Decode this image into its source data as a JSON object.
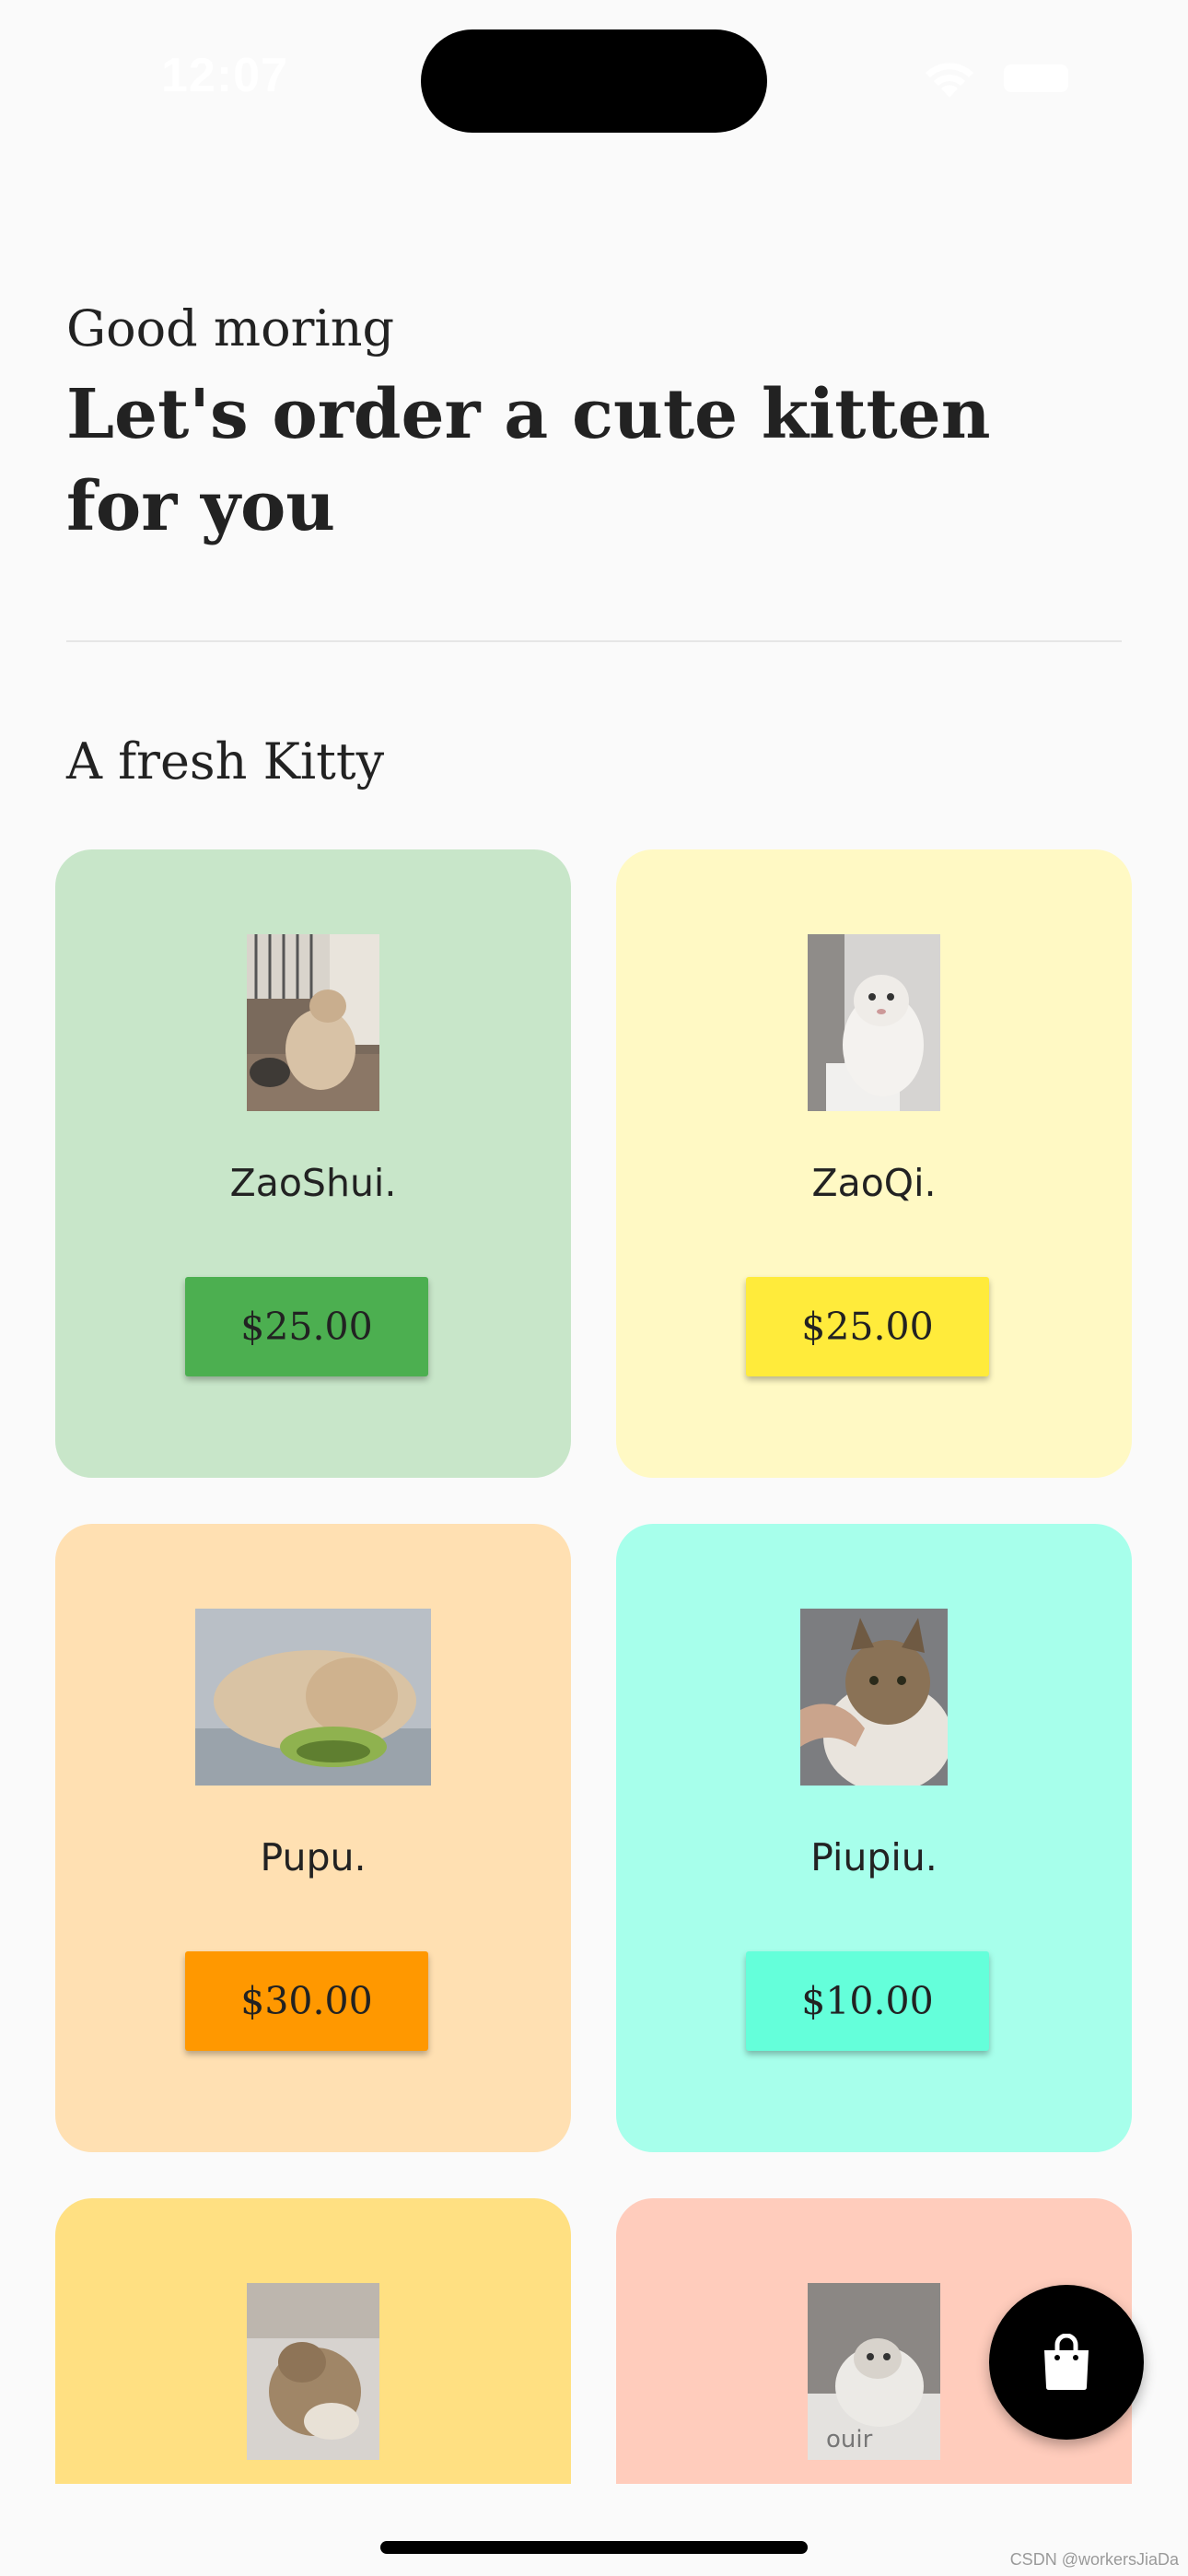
{
  "status_bar": {
    "time": "12:07"
  },
  "header": {
    "greeting": "Good moring",
    "headline": "Let's order a cute kitten for you"
  },
  "section": {
    "title": "A fresh Kitty"
  },
  "cards": [
    {
      "name": "ZaoShui.",
      "price": "$25.00",
      "bg_color": "#c8e6c9",
      "button_color": "#4caf50",
      "photo": "cat-photo-zaoshui"
    },
    {
      "name": "ZaoQi.",
      "price": "$25.00",
      "bg_color": "#fff9c4",
      "button_color": "#ffeb3b",
      "photo": "cat-photo-zaoqi"
    },
    {
      "name": "Pupu.",
      "price": "$30.00",
      "bg_color": "#ffe0b2",
      "button_color": "#ff9800",
      "photo": "cat-photo-pupu"
    },
    {
      "name": "Piupiu.",
      "price": "$10.00",
      "bg_color": "#a7ffeb",
      "button_color": "#64ffda",
      "photo": "cat-photo-piupiu"
    },
    {
      "bg_color": "#ffe082",
      "photo": "cat-photo-5"
    },
    {
      "bg_color": "#ffccbc",
      "photo": "cat-photo-6"
    }
  ],
  "fab": {
    "icon": "shopping-bag-icon"
  },
  "watermark": "CSDN @workersJiaDa"
}
